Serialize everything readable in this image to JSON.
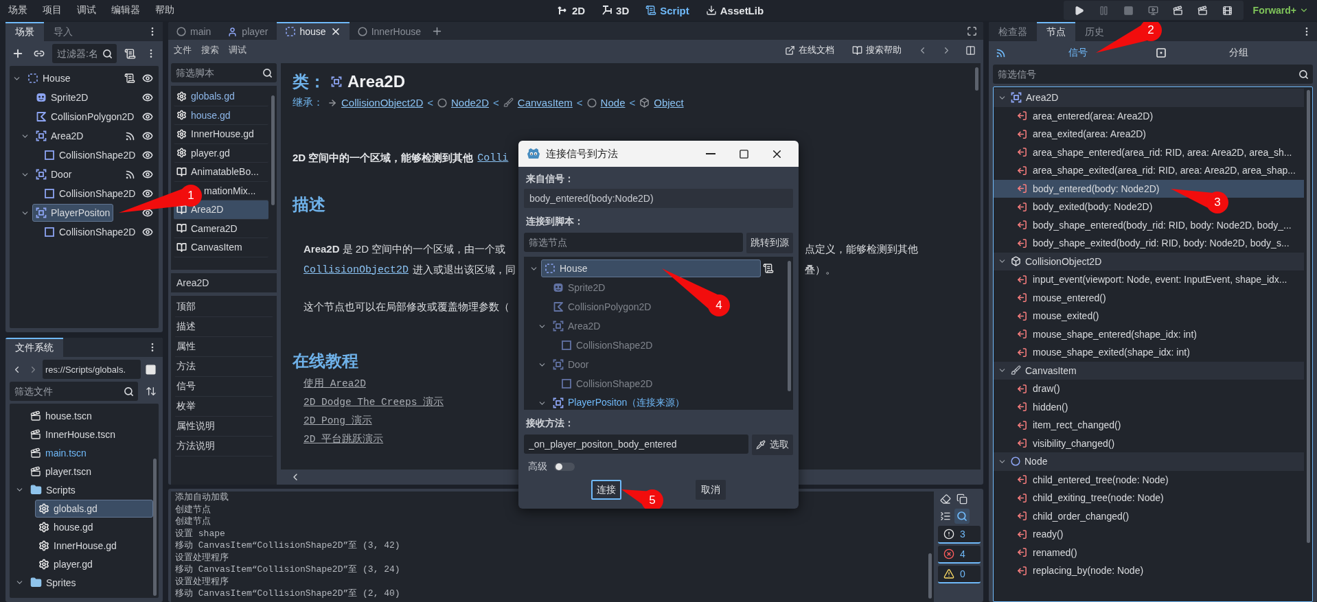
{
  "menu": [
    "场景",
    "项目",
    "调试",
    "编辑器",
    "帮助"
  ],
  "modes": [
    {
      "kind": "plane",
      "label": "2D",
      "selected": false
    },
    {
      "kind": "space",
      "label": "3D",
      "selected": false
    },
    {
      "kind": "script",
      "label": "Script",
      "selected": true
    },
    {
      "kind": "assetlib",
      "label": "AssetLib",
      "selected": false
    }
  ],
  "run_buttons": [
    {
      "kind": "play"
    },
    {
      "kind": "pause"
    },
    {
      "kind": "stop"
    },
    {
      "kind": "remote"
    },
    {
      "kind": "play_scene"
    },
    {
      "kind": "play_custom"
    },
    {
      "kind": "movie"
    }
  ],
  "renderer": "Forward+",
  "scene_dock": {
    "tabs": [
      {
        "label": "场景",
        "selected": true
      },
      {
        "label": "导入",
        "selected": false
      }
    ],
    "filter": {
      "placeholder": "过滤器:名"
    },
    "tree": [
      {
        "name": "House",
        "kind": "node2d",
        "expanded": true,
        "script": true,
        "signals": false,
        "visible": true,
        "selected": false,
        "children": [
          {
            "name": "Sprite2D",
            "kind": "sprite",
            "script": false,
            "signals": false,
            "visible": true,
            "selected": false
          },
          {
            "name": "CollisionPolygon2D",
            "kind": "polygon",
            "script": false,
            "signals": false,
            "visible": true,
            "selected": false
          },
          {
            "name": "Area2D",
            "kind": "area",
            "expanded": true,
            "script": false,
            "signals": true,
            "visible": true,
            "selected": false,
            "children": [
              {
                "name": "CollisionShape2D",
                "kind": "shape",
                "script": false,
                "signals": false,
                "visible": true,
                "selected": false
              }
            ]
          },
          {
            "name": "Door",
            "kind": "area",
            "expanded": true,
            "script": false,
            "signals": true,
            "visible": true,
            "selected": false,
            "children": [
              {
                "name": "CollisionShape2D",
                "kind": "shape",
                "script": false,
                "signals": false,
                "visible": true,
                "selected": false
              }
            ]
          },
          {
            "name": "PlayerPositon",
            "kind": "area",
            "expanded": true,
            "script": false,
            "signals": false,
            "visible": true,
            "selected": true,
            "callout": "1",
            "children": [
              {
                "name": "CollisionShape2D",
                "kind": "shape",
                "script": false,
                "signals": false,
                "visible": true,
                "selected": false
              }
            ]
          }
        ]
      }
    ]
  },
  "filesystem": {
    "tabs": [
      {
        "label": "文件系统",
        "selected": true
      }
    ],
    "path": "res://Scripts/globals.",
    "filter": {
      "placeholder": "筛选文件"
    },
    "tree": [
      {
        "name": "house.tscn",
        "kind": "scene",
        "main": false,
        "selected": false
      },
      {
        "name": "InnerHouse.tscn",
        "kind": "scene",
        "main": false,
        "selected": false
      },
      {
        "name": "main.tscn",
        "kind": "scene",
        "main": true,
        "selected": false
      },
      {
        "name": "player.tscn",
        "kind": "scene",
        "main": false,
        "selected": false
      },
      {
        "name": "Scripts",
        "kind": "folder",
        "expanded": true,
        "selected": false,
        "children": [
          {
            "name": "globals.gd",
            "kind": "script",
            "selected": true
          },
          {
            "name": "house.gd",
            "kind": "script",
            "selected": false
          },
          {
            "name": "InnerHouse.gd",
            "kind": "script",
            "selected": false
          },
          {
            "name": "player.gd",
            "kind": "script",
            "selected": false
          }
        ]
      },
      {
        "name": "Sprites",
        "kind": "folder",
        "expanded": true,
        "selected": false
      }
    ]
  },
  "editor": {
    "tabs": [
      {
        "label": "main",
        "kind": "circle",
        "selected": false,
        "closable": false
      },
      {
        "label": "player",
        "kind": "character",
        "selected": false,
        "closable": false
      },
      {
        "label": "house",
        "kind": "node2d",
        "selected": true,
        "closable": true
      },
      {
        "label": "InnerHouse",
        "kind": "circle",
        "selected": false,
        "closable": false
      }
    ],
    "menu": [
      "文件",
      "搜索",
      "调试"
    ],
    "help_buttons": [
      {
        "kind": "external",
        "label": "在线文档"
      },
      {
        "kind": "doc",
        "label": "搜索帮助"
      }
    ],
    "script_filter": {
      "placeholder": "筛选脚本"
    },
    "scripts": [
      {
        "label": "globals.gd",
        "kind": "script",
        "active": true,
        "selected": false
      },
      {
        "label": "house.gd",
        "kind": "script",
        "active": true,
        "selected": false
      },
      {
        "label": "InnerHouse.gd",
        "kind": "script",
        "active": false,
        "selected": false
      },
      {
        "label": "player.gd",
        "kind": "script",
        "active": false,
        "selected": false
      },
      {
        "label": "AnimatableBo...",
        "kind": "doc",
        "active": false,
        "selected": false
      },
      {
        "label": "mationMix...",
        "kind": "covered",
        "active": false,
        "selected": false
      },
      {
        "label": "Area2D",
        "kind": "doc",
        "active": false,
        "selected": true
      },
      {
        "label": "Camera2D",
        "kind": "doc",
        "active": false,
        "selected": false
      },
      {
        "label": "CanvasItem",
        "kind": "doc",
        "active": false,
        "selected": false
      }
    ],
    "members_title": "Area2D",
    "members": [
      "顶部",
      "描述",
      "属性",
      "方法",
      "信号",
      "枚举",
      "属性说明",
      "方法说明"
    ],
    "doc": {
      "class_label": "类：",
      "class_name": "Area2D",
      "inherits_label": "继承：",
      "separator": "<",
      "inherits": [
        {
          "name": "CollisionObject2D",
          "kind": "arrow"
        },
        {
          "name": "Node2D",
          "kind": "circle"
        },
        {
          "name": "CanvasItem",
          "kind": "brush"
        },
        {
          "name": "Node",
          "kind": "circle"
        },
        {
          "name": "Object",
          "kind": "cube"
        }
      ],
      "brief": {
        "text": "2D 空间中的一个区域，能够检测到其他",
        "link": "Colli"
      },
      "description_heading": "描述",
      "description_lines": [
        {
          "left": "**Area2D** 是 2D 空间中的一个区域，由一个或",
          "right": "点定义，能够检测到其他"
        },
        {
          "link": "CollisionObject2D",
          "left": "进入或退出该区域，同",
          "right": "叠）。"
        },
        {
          "left": "这个节点也可以在局部修改或覆盖物理参数（"
        }
      ],
      "tutorials_heading": "在线教程",
      "tutorials": [
        "使用 Area2D",
        "2D Dodge The Creeps 演示",
        "2D Pong 演示",
        "2D 平台跳跃演示"
      ]
    }
  },
  "output": {
    "lines": [
      "添加自动加载",
      "创建节点",
      "创建节点",
      "设置 shape",
      "移动 CanvasItem“CollisionShape2D”至 (3, 42)",
      "设置处理程序",
      "移动 CanvasItem“CollisionShape2D”至 (3, 24)",
      "设置处理程序",
      "移动 CanvasItem“CollisionShape2D”至 (2, 40)"
    ],
    "tools": [
      {
        "kind": "clear",
        "selected": false
      },
      {
        "kind": "copy",
        "selected": false
      },
      {
        "kind": "collapse",
        "selected": false
      },
      {
        "kind": "search",
        "selected": true
      }
    ],
    "counts": [
      {
        "kind": "message",
        "count": "3"
      },
      {
        "kind": "error",
        "count": "4"
      },
      {
        "kind": "warning",
        "count": "0"
      }
    ]
  },
  "node_dock": {
    "tabs": [
      {
        "label": "检查器",
        "selected": false
      },
      {
        "label": "节点",
        "selected": true
      },
      {
        "label": "历史",
        "selected": false
      }
    ],
    "subtabs": [
      {
        "kind": "signals",
        "label": "信号",
        "selected": true,
        "callout": "2"
      },
      {
        "kind": "groups",
        "label": "分组",
        "selected": false
      }
    ],
    "filter": {
      "placeholder": "筛选信号"
    },
    "groups": [
      {
        "name": "Area2D",
        "kind": "area",
        "expanded": true,
        "signals": [
          {
            "label": "area_entered(area: Area2D)",
            "selected": false
          },
          {
            "label": "area_exited(area: Area2D)",
            "selected": false
          },
          {
            "label": "area_shape_entered(area_rid: RID, area: Area2D, area_sh...",
            "selected": false
          },
          {
            "label": "area_shape_exited(area_rid: RID, area: Area2D, area_shap...",
            "selected": false
          },
          {
            "label": "body_entered(body: Node2D)",
            "selected": true,
            "callout": "3"
          },
          {
            "label": "body_exited(body: Node2D)",
            "selected": false
          },
          {
            "label": "body_shape_entered(body_rid: RID, body: Node2D, body_...",
            "selected": false
          },
          {
            "label": "body_shape_exited(body_rid: RID, body: Node2D, body_s...",
            "selected": false
          }
        ]
      },
      {
        "name": "CollisionObject2D",
        "kind": "cube",
        "expanded": true,
        "signals": [
          {
            "label": "input_event(viewport: Node, event: InputEvent, shape_idx...",
            "selected": false
          },
          {
            "label": "mouse_entered()",
            "selected": false
          },
          {
            "label": "mouse_exited()",
            "selected": false
          },
          {
            "label": "mouse_shape_entered(shape_idx: int)",
            "selected": false
          },
          {
            "label": "mouse_shape_exited(shape_idx: int)",
            "selected": false
          }
        ]
      },
      {
        "name": "CanvasItem",
        "kind": "brush",
        "expanded": true,
        "signals": [
          {
            "label": "draw()",
            "selected": false
          },
          {
            "label": "hidden()",
            "selected": false
          },
          {
            "label": "item_rect_changed()",
            "selected": false
          },
          {
            "label": "visibility_changed()",
            "selected": false
          }
        ]
      },
      {
        "name": "Node",
        "kind": "circle",
        "expanded": true,
        "signals": [
          {
            "label": "child_entered_tree(node: Node)",
            "selected": false
          },
          {
            "label": "child_exiting_tree(node: Node)",
            "selected": false
          },
          {
            "label": "child_order_changed()",
            "selected": false
          },
          {
            "label": "ready()",
            "selected": false
          },
          {
            "label": "renamed()",
            "selected": false
          },
          {
            "label": "replacing_by(node: Node)",
            "selected": false
          }
        ]
      }
    ]
  },
  "dialog": {
    "title": "连接信号到方法",
    "from_label": "来自信号：",
    "signal": "body_entered(body:Node2D)",
    "script_label": "连接到脚本：",
    "filter": {
      "placeholder": "筛选节点"
    },
    "jump_button": "跳转到源",
    "tree": [
      {
        "name": "House",
        "kind": "node2d",
        "expanded": true,
        "script": true,
        "disabled": false,
        "source": false,
        "selected": true,
        "callout": "4",
        "children": [
          {
            "name": "Sprite2D",
            "kind": "sprite",
            "script": false,
            "disabled": true,
            "source": false,
            "selected": false
          },
          {
            "name": "CollisionPolygon2D",
            "kind": "polygon",
            "script": false,
            "disabled": true,
            "source": false,
            "selected": false
          },
          {
            "name": "Area2D",
            "kind": "area",
            "expanded": true,
            "script": false,
            "disabled": true,
            "source": false,
            "selected": false,
            "children": [
              {
                "name": "CollisionShape2D",
                "kind": "shape",
                "script": false,
                "disabled": true,
                "source": false,
                "selected": false
              }
            ]
          },
          {
            "name": "Door",
            "kind": "area",
            "expanded": true,
            "script": false,
            "disabled": true,
            "source": false,
            "selected": false,
            "children": [
              {
                "name": "CollisionShape2D",
                "kind": "shape",
                "script": false,
                "disabled": true,
                "source": false,
                "selected": false
              }
            ]
          },
          {
            "name": "PlayerPositon",
            "kind": "area",
            "expanded": true,
            "script": false,
            "disabled": false,
            "source": true,
            "note": "（连接来源）",
            "selected": false
          }
        ]
      }
    ],
    "method_label": "接收方法：",
    "method": "_on_player_positon_body_entered",
    "pick_button": "选取",
    "advanced_label": "高级",
    "advanced": false,
    "buttons": [
      {
        "label": "连接",
        "focused": true,
        "callout": "5"
      },
      {
        "label": "取消",
        "focused": false
      }
    ]
  }
}
